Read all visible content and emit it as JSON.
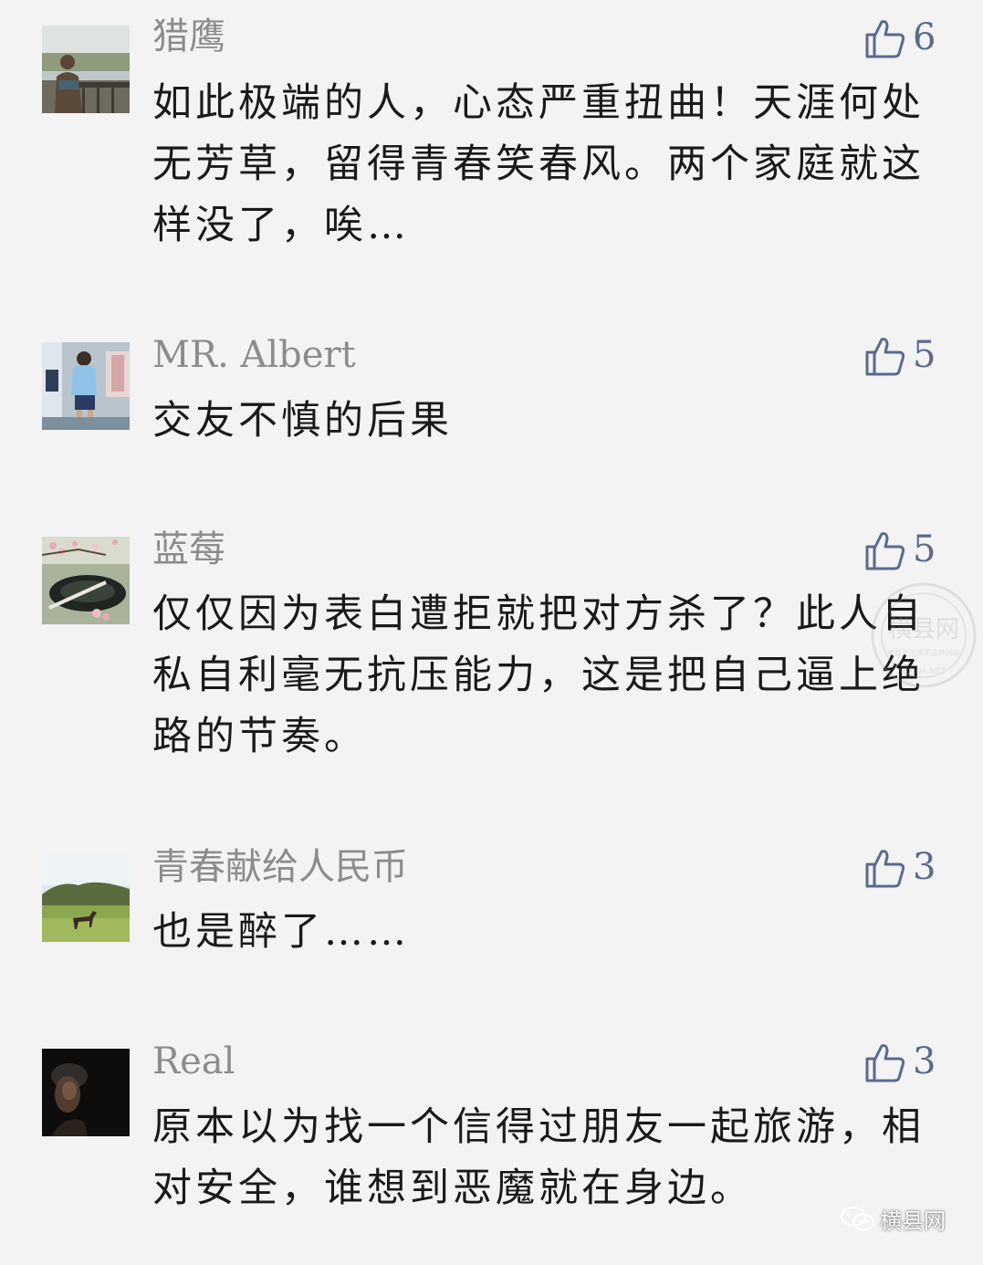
{
  "comments": [
    {
      "name": "猎鹰",
      "likes": "6",
      "avatar_icon": "person-on-balcony-photo",
      "text": "如此极端的人，心态严重扭曲！天涯何处无芳草，留得青春笑春风。两个家庭就这样没了，唉…"
    },
    {
      "name": "MR. Albert",
      "likes": "5",
      "avatar_icon": "person-in-room-photo",
      "text": "交友不慎的后果"
    },
    {
      "name": "蓝莓",
      "likes": "5",
      "avatar_icon": "blossom-still-life-photo",
      "text": "仅仅因为表白遭拒就把对方杀了？此人自私自利毫无抗压能力，这是把自己逼上绝路的节奏。"
    },
    {
      "name": "青春献给人民币",
      "likes": "3",
      "avatar_icon": "horse-meadow-photo",
      "text": "也是醉了……"
    },
    {
      "name": "Real",
      "likes": "3",
      "avatar_icon": "dark-portrait-photo",
      "text": "原本以为找一个信得过朋友一起旅游，相对安全，谁想到恶魔就在身边。"
    }
  ],
  "watermark": {
    "seal_title": "横县网",
    "seal_sub": "横县生活资讯品牌网站",
    "seal_domain": "HXIDA.NET"
  },
  "footer": {
    "brand": "横县网",
    "icon": "wechat-icon"
  },
  "colors": {
    "background": "#f3f3f3",
    "name": "#8c8c8c",
    "text": "#1a1a1a",
    "like": "#5b6a8c"
  }
}
